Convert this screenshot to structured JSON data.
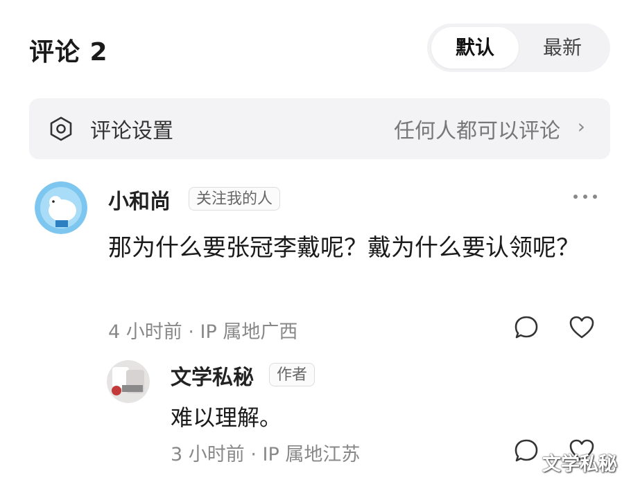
{
  "header": {
    "title": "评论 2"
  },
  "sort": {
    "default_label": "默认",
    "latest_label": "最新"
  },
  "settings": {
    "label": "评论设置",
    "value": "任何人都可以评论",
    "chevron": "›"
  },
  "comments": [
    {
      "username": "小和尚",
      "badge": "关注我的人",
      "content": "那为什么要张冠李戴呢？戴为什么要认领呢？",
      "meta": "4 小时前 · IP 属地广西"
    },
    {
      "username": "文学私秘",
      "badge": "作者",
      "content": "难以理解。",
      "meta": "3 小时前 · IP 属地江苏"
    }
  ],
  "icons": {
    "settings": "settings-icon",
    "more": "more-icon",
    "reply": "comment-bubble-icon",
    "like": "heart-icon"
  },
  "watermark": "文学私秘"
}
